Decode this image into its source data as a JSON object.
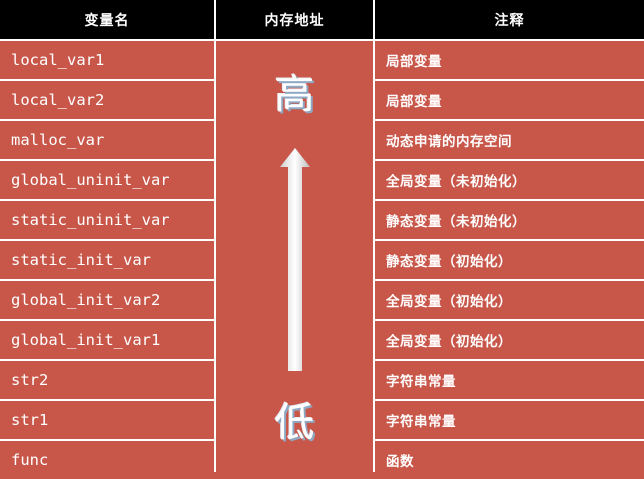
{
  "headers": {
    "name": "变量名",
    "address": "内存地址",
    "comment": "注释"
  },
  "rows": [
    {
      "name": "local_var1",
      "comment": "局部变量"
    },
    {
      "name": "local_var2",
      "comment": "局部变量"
    },
    {
      "name": "malloc_var",
      "comment": "动态申请的内存空间"
    },
    {
      "name": "global_uninit_var",
      "comment": "全局变量（未初始化）"
    },
    {
      "name": "static_uninit_var",
      "comment": "静态变量（未初始化）"
    },
    {
      "name": "static_init_var",
      "comment": "静态变量（初始化）"
    },
    {
      "name": "global_init_var2",
      "comment": "全局变量（初始化）"
    },
    {
      "name": "global_init_var1",
      "comment": "全局变量（初始化）"
    },
    {
      "name": "str2",
      "comment": "字符串常量"
    },
    {
      "name": "str1",
      "comment": "字符串常量"
    },
    {
      "name": "func",
      "comment": "函数"
    }
  ],
  "address_labels": {
    "high": "高",
    "low": "低"
  },
  "arrow_icon": "up-arrow-icon",
  "colors": {
    "header_bg": "#000000",
    "cell_bg": "#c8574a",
    "text": "#ffffff",
    "divider": "#ffffff"
  }
}
